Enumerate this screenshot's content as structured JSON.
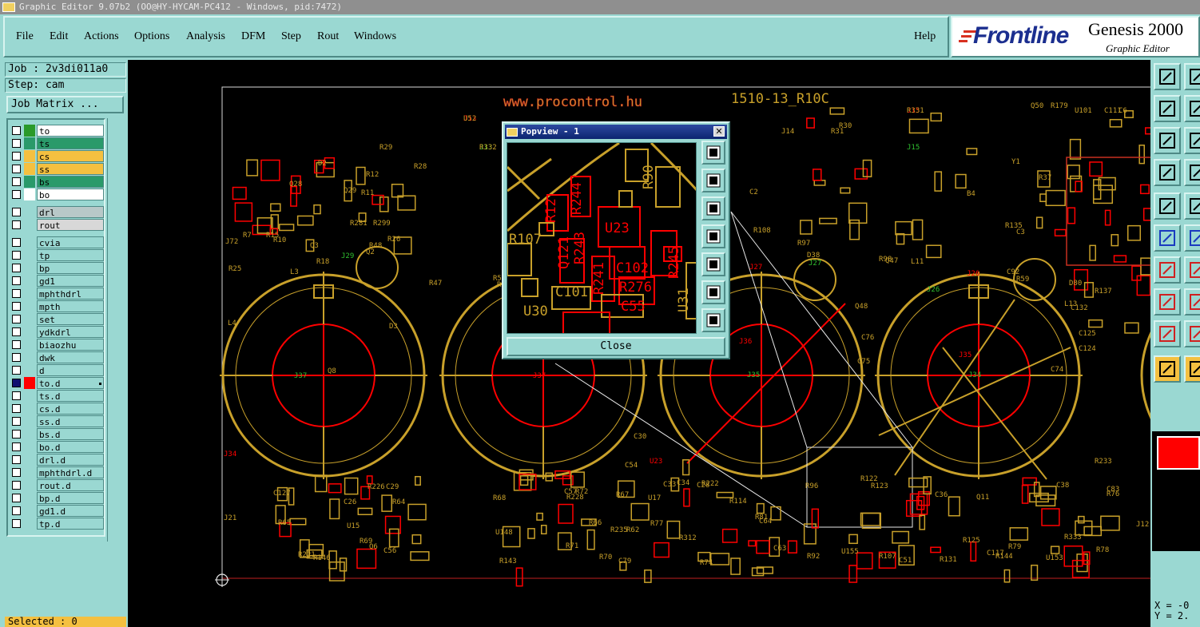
{
  "window": {
    "title": "Graphic Editor 9.07b2 (OO@HY-HYCAM-PC412 - Windows, pid:7472)"
  },
  "menu": {
    "items": [
      {
        "label": "File"
      },
      {
        "label": "Edit"
      },
      {
        "label": "Actions"
      },
      {
        "label": "Options"
      },
      {
        "label": "Analysis"
      },
      {
        "label": "DFM"
      },
      {
        "label": "Step"
      },
      {
        "label": "Rout"
      },
      {
        "label": "Windows"
      }
    ],
    "help": "Help"
  },
  "logo": {
    "brand": "Frontline",
    "product": "Genesis 2000",
    "subtitle": "Graphic Editor"
  },
  "job": {
    "job_label": "Job : 2v3di011a0",
    "step_label": "Step: cam",
    "matrix_button": "Job Matrix ..."
  },
  "layers": [
    {
      "name": "to",
      "color": "#2a9a2a",
      "bg": "#ffffff"
    },
    {
      "name": "ts",
      "color": "#2a9a6a",
      "bg": "#2a9a6a"
    },
    {
      "name": "cs",
      "color": "#f4c040",
      "bg": "#f4c040"
    },
    {
      "name": "ss",
      "color": "#f4c040",
      "bg": "#f4c040"
    },
    {
      "name": "bs",
      "color": "#2a9a6a",
      "bg": "#2a9a6a"
    },
    {
      "name": "bo",
      "color": "#ffffff",
      "bg": "#ffffff"
    },
    {
      "name": "drl",
      "color": "#9ad8d2",
      "bg": "#b8c8c8"
    },
    {
      "name": "rout",
      "color": "#9ad8d2",
      "bg": "#d8d8d8"
    },
    {
      "name": "cvia"
    },
    {
      "name": "tp"
    },
    {
      "name": "bp"
    },
    {
      "name": "gd1"
    },
    {
      "name": "mphthdrl"
    },
    {
      "name": "mpth"
    },
    {
      "name": "set"
    },
    {
      "name": "ydkdrl"
    },
    {
      "name": "biaozhu"
    },
    {
      "name": "dwk"
    },
    {
      "name": "d"
    },
    {
      "name": "to.d",
      "color": "#ff0000",
      "active": true
    },
    {
      "name": "ts.d"
    },
    {
      "name": "cs.d"
    },
    {
      "name": "ss.d"
    },
    {
      "name": "bs.d"
    },
    {
      "name": "bo.d"
    },
    {
      "name": "drl.d"
    },
    {
      "name": "mphthdrl.d"
    },
    {
      "name": "rout.d"
    },
    {
      "name": "bp.d"
    },
    {
      "name": "gd1.d"
    },
    {
      "name": "tp.d"
    }
  ],
  "status": {
    "selected": "Selected : 0"
  },
  "coords": {
    "x": "X = -0",
    "y": "Y = 2."
  },
  "colors": {
    "panel": "#9ad8d2",
    "copper": "#c8a02a",
    "highlight": "#ff0000",
    "canvas": "#000000"
  },
  "board": {
    "title": "1510-13_R10C",
    "url": "www.procontrol.hu",
    "ref_labels": [
      {
        "t": "J13",
        "c": "r"
      },
      {
        "t": "J13",
        "c": "g"
      },
      {
        "t": "J15",
        "c": "r"
      },
      {
        "t": "J15",
        "c": "g"
      },
      {
        "t": "D2",
        "c": "y"
      },
      {
        "t": "R29",
        "c": "y"
      },
      {
        "t": "R28",
        "c": "y"
      },
      {
        "t": "R12",
        "c": "y"
      },
      {
        "t": "R11",
        "c": "y"
      },
      {
        "t": "Q28",
        "c": "y"
      },
      {
        "t": "Q29",
        "c": "y"
      },
      {
        "t": "R281",
        "c": "y"
      },
      {
        "t": "R299",
        "c": "y"
      },
      {
        "t": "R15",
        "c": "y"
      },
      {
        "t": "R7",
        "c": "y"
      },
      {
        "t": "J72",
        "c": "y"
      },
      {
        "t": "R26",
        "c": "y"
      },
      {
        "t": "R10",
        "c": "y"
      },
      {
        "t": "Q3",
        "c": "y"
      },
      {
        "t": "R48",
        "c": "y"
      },
      {
        "t": "J29",
        "c": "g"
      },
      {
        "t": "Q2",
        "c": "y"
      },
      {
        "t": "R18",
        "c": "y"
      },
      {
        "t": "R47",
        "c": "y"
      },
      {
        "t": "R25",
        "c": "y"
      },
      {
        "t": "R54",
        "c": "y"
      },
      {
        "t": "R24",
        "c": "y"
      },
      {
        "t": "D3",
        "c": "y"
      },
      {
        "t": "L4",
        "c": "y"
      },
      {
        "t": "L3",
        "c": "y"
      },
      {
        "t": "Q8",
        "c": "y"
      },
      {
        "t": "J37",
        "c": "g"
      },
      {
        "t": "J37",
        "c": "r"
      },
      {
        "t": "J36",
        "c": "r"
      },
      {
        "t": "J35",
        "c": "g"
      },
      {
        "t": "J35",
        "c": "r"
      },
      {
        "t": "J34",
        "c": "g"
      },
      {
        "t": "J34",
        "c": "r"
      },
      {
        "t": "J21",
        "c": "y"
      },
      {
        "t": "J12",
        "c": "y"
      },
      {
        "t": "J14",
        "c": "y"
      },
      {
        "t": "R31",
        "c": "y"
      },
      {
        "t": "R30",
        "c": "y"
      },
      {
        "t": "Q50",
        "c": "y"
      },
      {
        "t": "R179",
        "c": "y"
      },
      {
        "t": "U101",
        "c": "y"
      },
      {
        "t": "C111",
        "c": "y"
      },
      {
        "t": "C6",
        "c": "y"
      },
      {
        "t": "Y1",
        "c": "y"
      },
      {
        "t": "R37",
        "c": "y"
      },
      {
        "t": "C2",
        "c": "y"
      },
      {
        "t": "B4",
        "c": "y"
      },
      {
        "t": "D5",
        "c": "y"
      },
      {
        "t": "R108",
        "c": "y"
      },
      {
        "t": "R97",
        "c": "y"
      },
      {
        "t": "D38",
        "c": "y"
      },
      {
        "t": "J27",
        "c": "g"
      },
      {
        "t": "J27",
        "c": "r"
      },
      {
        "t": "R98",
        "c": "y"
      },
      {
        "t": "Q47",
        "c": "y"
      },
      {
        "t": "L11",
        "c": "y"
      },
      {
        "t": "R135",
        "c": "y"
      },
      {
        "t": "C3",
        "c": "y"
      },
      {
        "t": "J26",
        "c": "g"
      },
      {
        "t": "J26",
        "c": "r"
      },
      {
        "t": "C92",
        "c": "y"
      },
      {
        "t": "R59",
        "c": "y"
      },
      {
        "t": "D80",
        "c": "y"
      },
      {
        "t": "R137",
        "c": "y"
      },
      {
        "t": "L13",
        "c": "y"
      },
      {
        "t": "C132",
        "c": "y"
      },
      {
        "t": "Q48",
        "c": "y"
      },
      {
        "t": "C76",
        "c": "y"
      },
      {
        "t": "C75",
        "c": "y"
      },
      {
        "t": "C74",
        "c": "y"
      },
      {
        "t": "C125",
        "c": "y"
      },
      {
        "t": "C124",
        "c": "y"
      },
      {
        "t": "C127",
        "c": "y"
      },
      {
        "t": "R226",
        "c": "y"
      },
      {
        "t": "C29",
        "c": "y"
      },
      {
        "t": "C26",
        "c": "y"
      },
      {
        "t": "R64",
        "c": "y"
      },
      {
        "t": "R65",
        "c": "y"
      },
      {
        "t": "U15",
        "c": "y"
      },
      {
        "t": "Q6",
        "c": "y"
      },
      {
        "t": "R69",
        "c": "y"
      },
      {
        "t": "C56",
        "c": "y"
      },
      {
        "t": "R221",
        "c": "y"
      },
      {
        "t": "R146",
        "c": "y"
      },
      {
        "t": "R68",
        "c": "y"
      },
      {
        "t": "R228",
        "c": "y"
      },
      {
        "t": "R66",
        "c": "y"
      },
      {
        "t": "R67",
        "c": "y"
      },
      {
        "t": "U17",
        "c": "y"
      },
      {
        "t": "U148",
        "c": "y"
      },
      {
        "t": "R143",
        "c": "y"
      },
      {
        "t": "R71",
        "c": "y"
      },
      {
        "t": "R70",
        "c": "y"
      },
      {
        "t": "C79",
        "c": "y"
      },
      {
        "t": "R235",
        "c": "y"
      },
      {
        "t": "R62",
        "c": "y"
      },
      {
        "t": "R77",
        "c": "y"
      },
      {
        "t": "R312",
        "c": "y"
      },
      {
        "t": "R74",
        "c": "y"
      },
      {
        "t": "R114",
        "c": "y"
      },
      {
        "t": "C34",
        "c": "y"
      },
      {
        "t": "R81",
        "c": "y"
      },
      {
        "t": "C64",
        "c": "y"
      },
      {
        "t": "C63",
        "c": "y"
      },
      {
        "t": "R92",
        "c": "y"
      },
      {
        "t": "R96",
        "c": "y"
      },
      {
        "t": "R107",
        "c": "y"
      },
      {
        "t": "U155",
        "c": "y"
      },
      {
        "t": "C51",
        "c": "y"
      },
      {
        "t": "R131",
        "c": "y"
      },
      {
        "t": "R125",
        "c": "y"
      },
      {
        "t": "C117",
        "c": "y"
      },
      {
        "t": "R144",
        "c": "y"
      },
      {
        "t": "R79",
        "c": "y"
      },
      {
        "t": "U153",
        "c": "y"
      },
      {
        "t": "R333",
        "c": "y"
      },
      {
        "t": "R78",
        "c": "y"
      },
      {
        "t": "C83",
        "c": "y"
      },
      {
        "t": "R233",
        "c": "y"
      },
      {
        "t": "R76",
        "c": "y"
      },
      {
        "t": "C38",
        "c": "y"
      },
      {
        "t": "C36",
        "c": "y"
      },
      {
        "t": "Q11",
        "c": "y"
      },
      {
        "t": "R123",
        "c": "y"
      },
      {
        "t": "R122",
        "c": "y"
      },
      {
        "t": "C54",
        "c": "y"
      },
      {
        "t": "U23",
        "c": "r"
      },
      {
        "t": "C30",
        "c": "y"
      },
      {
        "t": "C28",
        "c": "y"
      },
      {
        "t": "R222",
        "c": "y"
      },
      {
        "t": "C33",
        "c": "y"
      },
      {
        "t": "R72",
        "c": "y"
      },
      {
        "t": "C57",
        "c": "y"
      },
      {
        "t": "U52",
        "c": "y"
      },
      {
        "t": "R332",
        "c": "y"
      },
      {
        "t": "R331",
        "c": "y"
      }
    ]
  },
  "popview": {
    "title": "Popview - 1",
    "close_label": "Close",
    "labels": [
      {
        "t": "R90",
        "c": "y"
      },
      {
        "t": "R12",
        "c": "r"
      },
      {
        "t": "R244",
        "c": "r"
      },
      {
        "t": "U23",
        "c": "r"
      },
      {
        "t": "R107",
        "c": "y"
      },
      {
        "t": "Q121",
        "c": "r"
      },
      {
        "t": "R243",
        "c": "r"
      },
      {
        "t": "R245",
        "c": "r"
      },
      {
        "t": "C102",
        "c": "r"
      },
      {
        "t": "R241",
        "c": "r"
      },
      {
        "t": "R276",
        "c": "r"
      },
      {
        "t": "C101",
        "c": "y"
      },
      {
        "t": "C55",
        "c": "r"
      },
      {
        "t": "U30",
        "c": "y"
      },
      {
        "t": "U31",
        "c": "y"
      }
    ]
  }
}
